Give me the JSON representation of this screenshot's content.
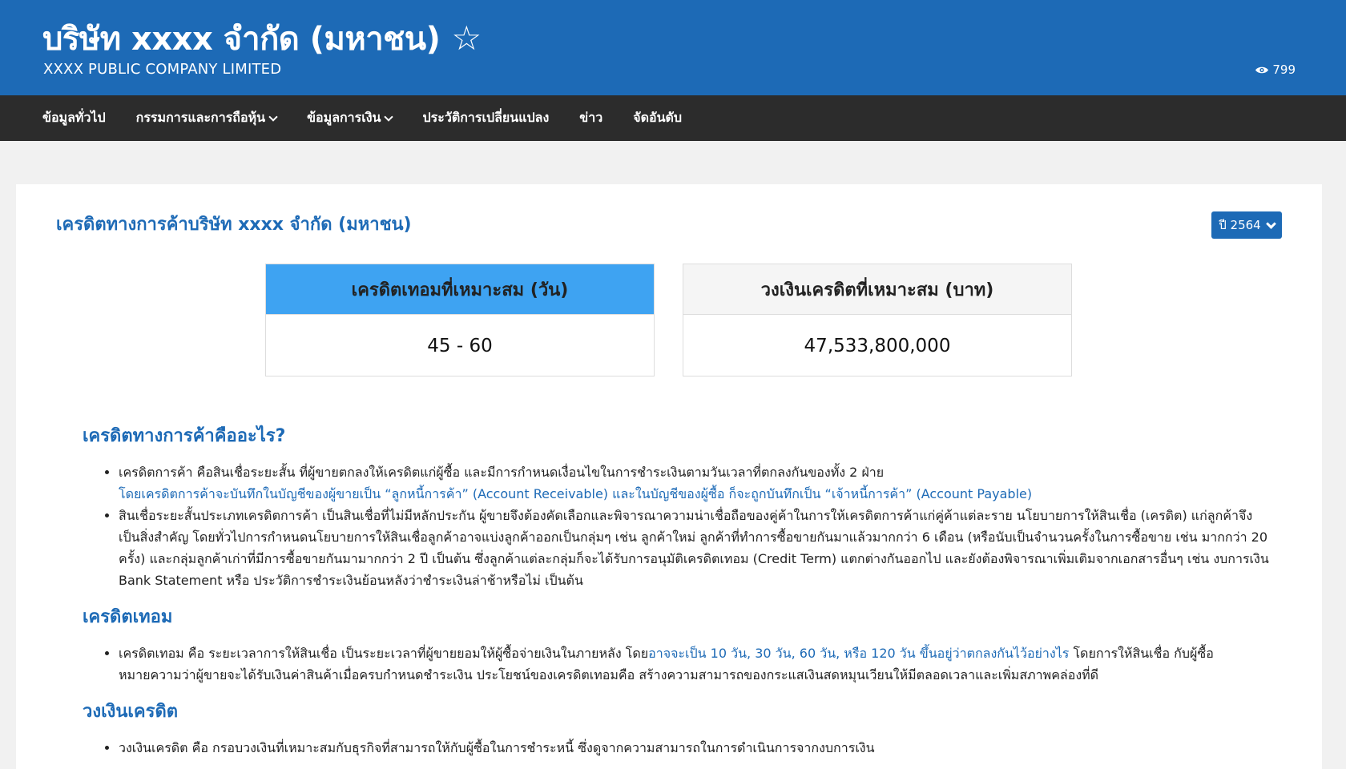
{
  "header": {
    "title_th": "บริษัท xxxx จำกัด (มหาชน)",
    "title_en": "XXXX PUBLIC COMPANY LIMITED",
    "views": "799"
  },
  "nav": {
    "items": [
      {
        "label": "ข้อมูลทั่วไป",
        "dropdown": false
      },
      {
        "label": "กรรมการและการถือหุ้น",
        "dropdown": true
      },
      {
        "label": "ข้อมูลการเงิน",
        "dropdown": true
      },
      {
        "label": "ประวัติการเปลี่ยนแปลง",
        "dropdown": false
      },
      {
        "label": "ข่าว",
        "dropdown": false
      },
      {
        "label": "จัดอันดับ",
        "dropdown": false
      }
    ]
  },
  "card": {
    "title": "เครดิตทางการค้าบริษัท xxxx จำกัด (มหาชน)",
    "year_label": "ปี 2564",
    "credit_term": {
      "label": "เครดิตเทอมที่เหมาะสม (วัน)",
      "value": "45 - 60"
    },
    "credit_limit": {
      "label": "วงเงินเครดิตที่เหมาะสม (บาท)",
      "value": "47,533,800,000"
    }
  },
  "sections": {
    "s1": {
      "heading": "เครดิตทางการค้าคืออะไร?",
      "b1_text": "เครดิตการค้า คือสินเชื่อระยะสั้น ที่ผู้ขายตกลงให้เครดิตแก่ผู้ซื้อ และมีการกำหนดเงื่อนไขในการชำระเงินตามวันเวลาที่ตกลงกันของทั้ง 2 ฝ่าย",
      "b1_blue": "โดยเครดิตการค้าจะบันทึกในบัญชีของผู้ขายเป็น “ลูกหนี้การค้า” (Account Receivable) และในบัญชีของผู้ซื้อ ก็จะถูกบันทึกเป็น “เจ้าหนี้การค้า” (Account Payable)",
      "b2_text": "สินเชื่อระยะสั้นประเภทเครดิตการค้า เป็นสินเชื่อที่ไม่มีหลักประกัน ผู้ขายจึงต้องคัดเลือกและพิจารณาความน่าเชื่อถือของคู่ค้าในการให้เครดิตการค้าแก่คู่ค้าแต่ละราย นโยบายการให้สินเชื่อ (เครดิต) แก่ลูกค้าจึงเป็นสิ่งสำคัญ โดยทั่วไปการกำหนดนโยบายการให้สินเชื่อลูกค้าอาจแบ่งลูกค้าออกเป็นกลุ่มๆ เช่น ลูกค้าใหม่ ลูกค้าที่ทำการซื้อขายกันมาแล้วมากกว่า 6 เดือน (หรือนับเป็นจำนวนครั้งในการซื้อขาย เช่น มากกว่า 20 ครั้ง) และกลุ่มลูกค้าเก่าที่มีการซื้อขายกันมามากกว่า 2 ปี เป็นต้น ซึ่งลูกค้าแต่ละกลุ่มก็จะได้รับการอนุมัติเครดิตเทอม (Credit Term) แตกต่างกันออกไป และยังต้องพิจารณาเพิ่มเติมจากเอกสารอื่นๆ เช่น งบการเงิน Bank Statement หรือ ประวัติการชำระเงินย้อนหลังว่าชำระเงินล่าช้าหรือไม่ เป็นต้น"
    },
    "s2": {
      "heading": "เครดิตเทอม",
      "b1_pre": "เครดิตเทอม คือ ระยะเวลาการให้สินเชื่อ เป็นระยะเวลาที่ผู้ขายยอมให้ผู้ซื้อจ่ายเงินในภายหลัง โดย",
      "b1_blue": "อาจจะเป็น 10 วัน, 30 วัน, 60 วัน, หรือ 120 วัน ขึ้นอยู่ว่าตกลงกันไว้อย่างไร",
      "b1_post": " โดยการให้สินเชื่อ กับผู้ซื้อหมายความว่าผู้ขายจะได้รับเงินค่าสินค้าเมื่อครบกำหนดชำระเงิน ประโยชน์ของเครดิตเทอมคือ สร้างความสามารถของกระแสเงินสดหมุนเวียนให้มีตลอดเวลาและเพิ่มสภาพคล่องที่ดี"
    },
    "s3": {
      "heading": "วงเงินเครดิต",
      "b1_text": "วงเงินเครดิต คือ กรอบวงเงินที่เหมาะสมกับธุรกิจที่สามารถให้กับผู้ซื้อในการชำระหนี้ ซึ่งดูจากความสามารถในการดำเนินการจากงบการเงิน"
    }
  }
}
